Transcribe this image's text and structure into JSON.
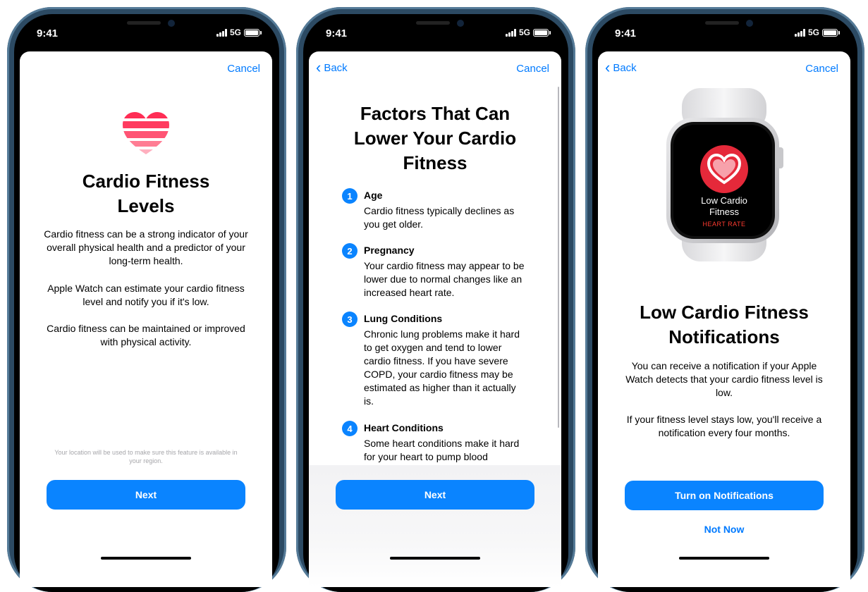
{
  "status": {
    "time": "9:41",
    "network": "5G"
  },
  "colors": {
    "accent": "#0a84ff",
    "heart_pink": "#ff2d55",
    "watch_red": "#e5293a"
  },
  "screen1": {
    "cancel": "Cancel",
    "icon": "striped-heart-icon",
    "title_line1": "Cardio Fitness",
    "title_line2": "Levels",
    "para1": "Cardio fitness can be a strong indicator of your overall physical health and a predictor of your long-term health.",
    "para2": "Apple Watch can estimate your cardio fitness level and notify you if it's low.",
    "para3": "Cardio fitness can be maintained or improved with physical activity.",
    "location_note": "Your location will be used to make sure this feature is available in your region.",
    "next": "Next"
  },
  "screen2": {
    "back": "Back",
    "cancel": "Cancel",
    "title_line1": "Factors That Can",
    "title_line2": "Lower Your Cardio",
    "title_line3": "Fitness",
    "factors": [
      {
        "num": "1",
        "title": "Age",
        "body": "Cardio fitness typically declines as you get older."
      },
      {
        "num": "2",
        "title": "Pregnancy",
        "body": "Your cardio fitness may appear to be lower due to normal changes like an increased heart rate."
      },
      {
        "num": "3",
        "title": "Lung Conditions",
        "body": "Chronic lung problems make it hard to get oxygen and tend to lower cardio fitness. If you have severe COPD, your cardio fitness may be estimated as higher than it actually is."
      },
      {
        "num": "4",
        "title": "Heart Conditions",
        "body": "Some heart conditions make it hard for your heart to pump blood"
      }
    ],
    "next": "Next"
  },
  "screen3": {
    "back": "Back",
    "cancel": "Cancel",
    "watch_icon": "heart-rate-icon",
    "watch_line1": "Low Cardio",
    "watch_line2": "Fitness",
    "watch_sub": "HEART RATE",
    "title_line1": "Low Cardio Fitness",
    "title_line2": "Notifications",
    "para1": "You can receive a notification if your Apple Watch detects that your cardio fitness level is low.",
    "para2": "If your fitness level stays low, you'll receive a notification every four months.",
    "primary": "Turn on Notifications",
    "secondary": "Not Now"
  }
}
